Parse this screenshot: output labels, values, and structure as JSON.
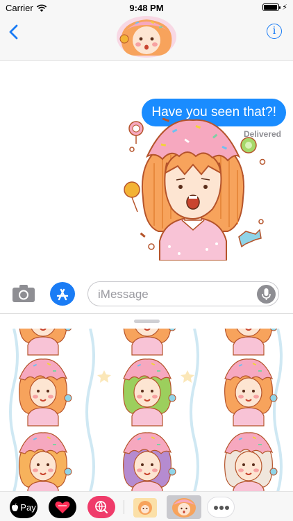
{
  "status_bar": {
    "carrier": "Carrier",
    "time": "9:48 PM",
    "charging_glyph": "⚡"
  },
  "conversation": {
    "message_text": "Have you seen that?!",
    "status_text": "Delivered"
  },
  "input_bar": {
    "placeholder": "iMessage"
  },
  "app_strip": {
    "pay_label": "Pay"
  },
  "icons": {
    "back": "back-chevron-icon",
    "info": "info-icon",
    "camera": "camera-icon",
    "apps": "app-store-icon",
    "mic": "microphone-icon",
    "apple": "apple-logo-icon",
    "heart": "heart-icon",
    "search": "globe-search-icon",
    "more": "ellipsis-icon"
  },
  "colors": {
    "accent_blue": "#1a7cf5",
    "bubble_blue": "#1a8cff",
    "hair_orange": "#f7a35c",
    "frosting_pink": "#f6a8bf",
    "search_pink": "#ef3b6a"
  }
}
